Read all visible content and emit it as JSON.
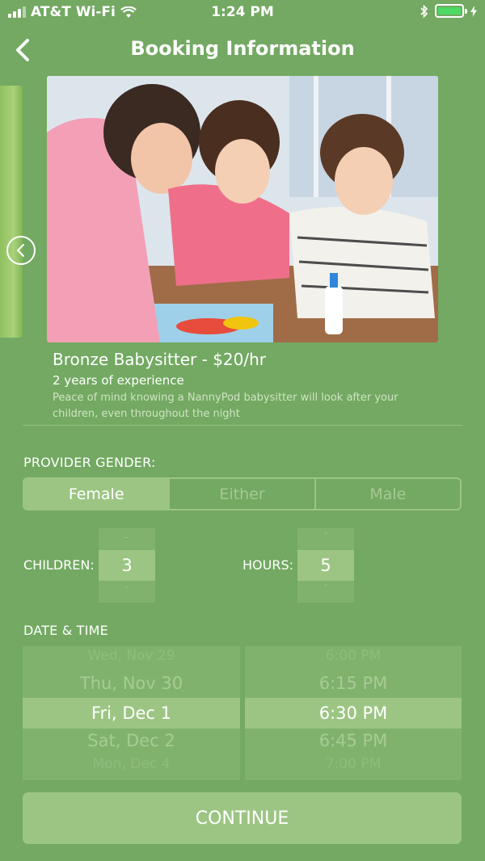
{
  "status_bar": {
    "carrier": "AT&T Wi-Fi",
    "time": "1:24 PM",
    "battery_color": "#4cd964"
  },
  "header": {
    "title": "Booking Information",
    "back_icon": "chevron-left-icon"
  },
  "carousel": {
    "prev_icon": "chevron-left-circle-icon",
    "image_subject": "woman drawing with two children at a table"
  },
  "provider": {
    "name": "Bronze Babysitter - $20/hr",
    "experience": "2 years of experience",
    "description": "Peace of mind knowing a NannyPod babysitter will look after your children, even throughout the night"
  },
  "gender": {
    "label": "PROVIDER GENDER:",
    "options": [
      "Female",
      "Either",
      "Male"
    ],
    "selected": "Female"
  },
  "children": {
    "label": "CHILDREN:",
    "value": "3"
  },
  "hours": {
    "label": "HOURS:",
    "value": "5"
  },
  "datetime": {
    "label": "DATE & TIME",
    "dates": {
      "above2": "Wed, Nov 29",
      "above1": "Thu, Nov 30",
      "selected": "Fri, Dec 1",
      "below1": "Sat, Dec 2",
      "below2": "Mon, Dec 4"
    },
    "times": {
      "above2": "6:00 PM",
      "above1": "6:15 PM",
      "selected": "6:30 PM",
      "below1": "6:45 PM",
      "below2": "7:00 PM"
    }
  },
  "continue_label": "CONTINUE",
  "colors": {
    "background": "#73a962",
    "accent": "#9cc583"
  }
}
